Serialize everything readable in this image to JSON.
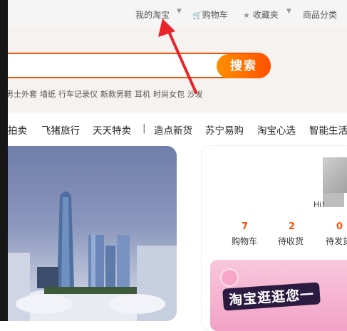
{
  "topbar": {
    "my_taobao": "我的淘宝",
    "cart": "购物车",
    "favorites": "收藏夹",
    "categories": "商品分类",
    "cart_icon": "cart-icon",
    "star_icon": "star-icon"
  },
  "search": {
    "button_label": "搜索",
    "placeholder": ""
  },
  "hot_words": [
    "男士外套",
    "墙纸",
    "行车记录仪",
    "新款男鞋",
    "耳机",
    "时尚女包",
    "沙发"
  ],
  "category_nav": [
    "拍卖",
    "飞猪旅行",
    "天天特卖",
    "|",
    "造点新货",
    "苏宁易购",
    "淘宝心选",
    "智能生活"
  ],
  "user_card": {
    "greeting": "Hi!",
    "stats": [
      {
        "value": "7",
        "label": "购物车"
      },
      {
        "value": "2",
        "label": "待收货"
      },
      {
        "value": "0",
        "label": "待发货"
      }
    ],
    "promo_title": "淘宝逛逛您一"
  },
  "colors": {
    "accent": "#ff5000",
    "annotation_arrow": "#e8232a"
  }
}
